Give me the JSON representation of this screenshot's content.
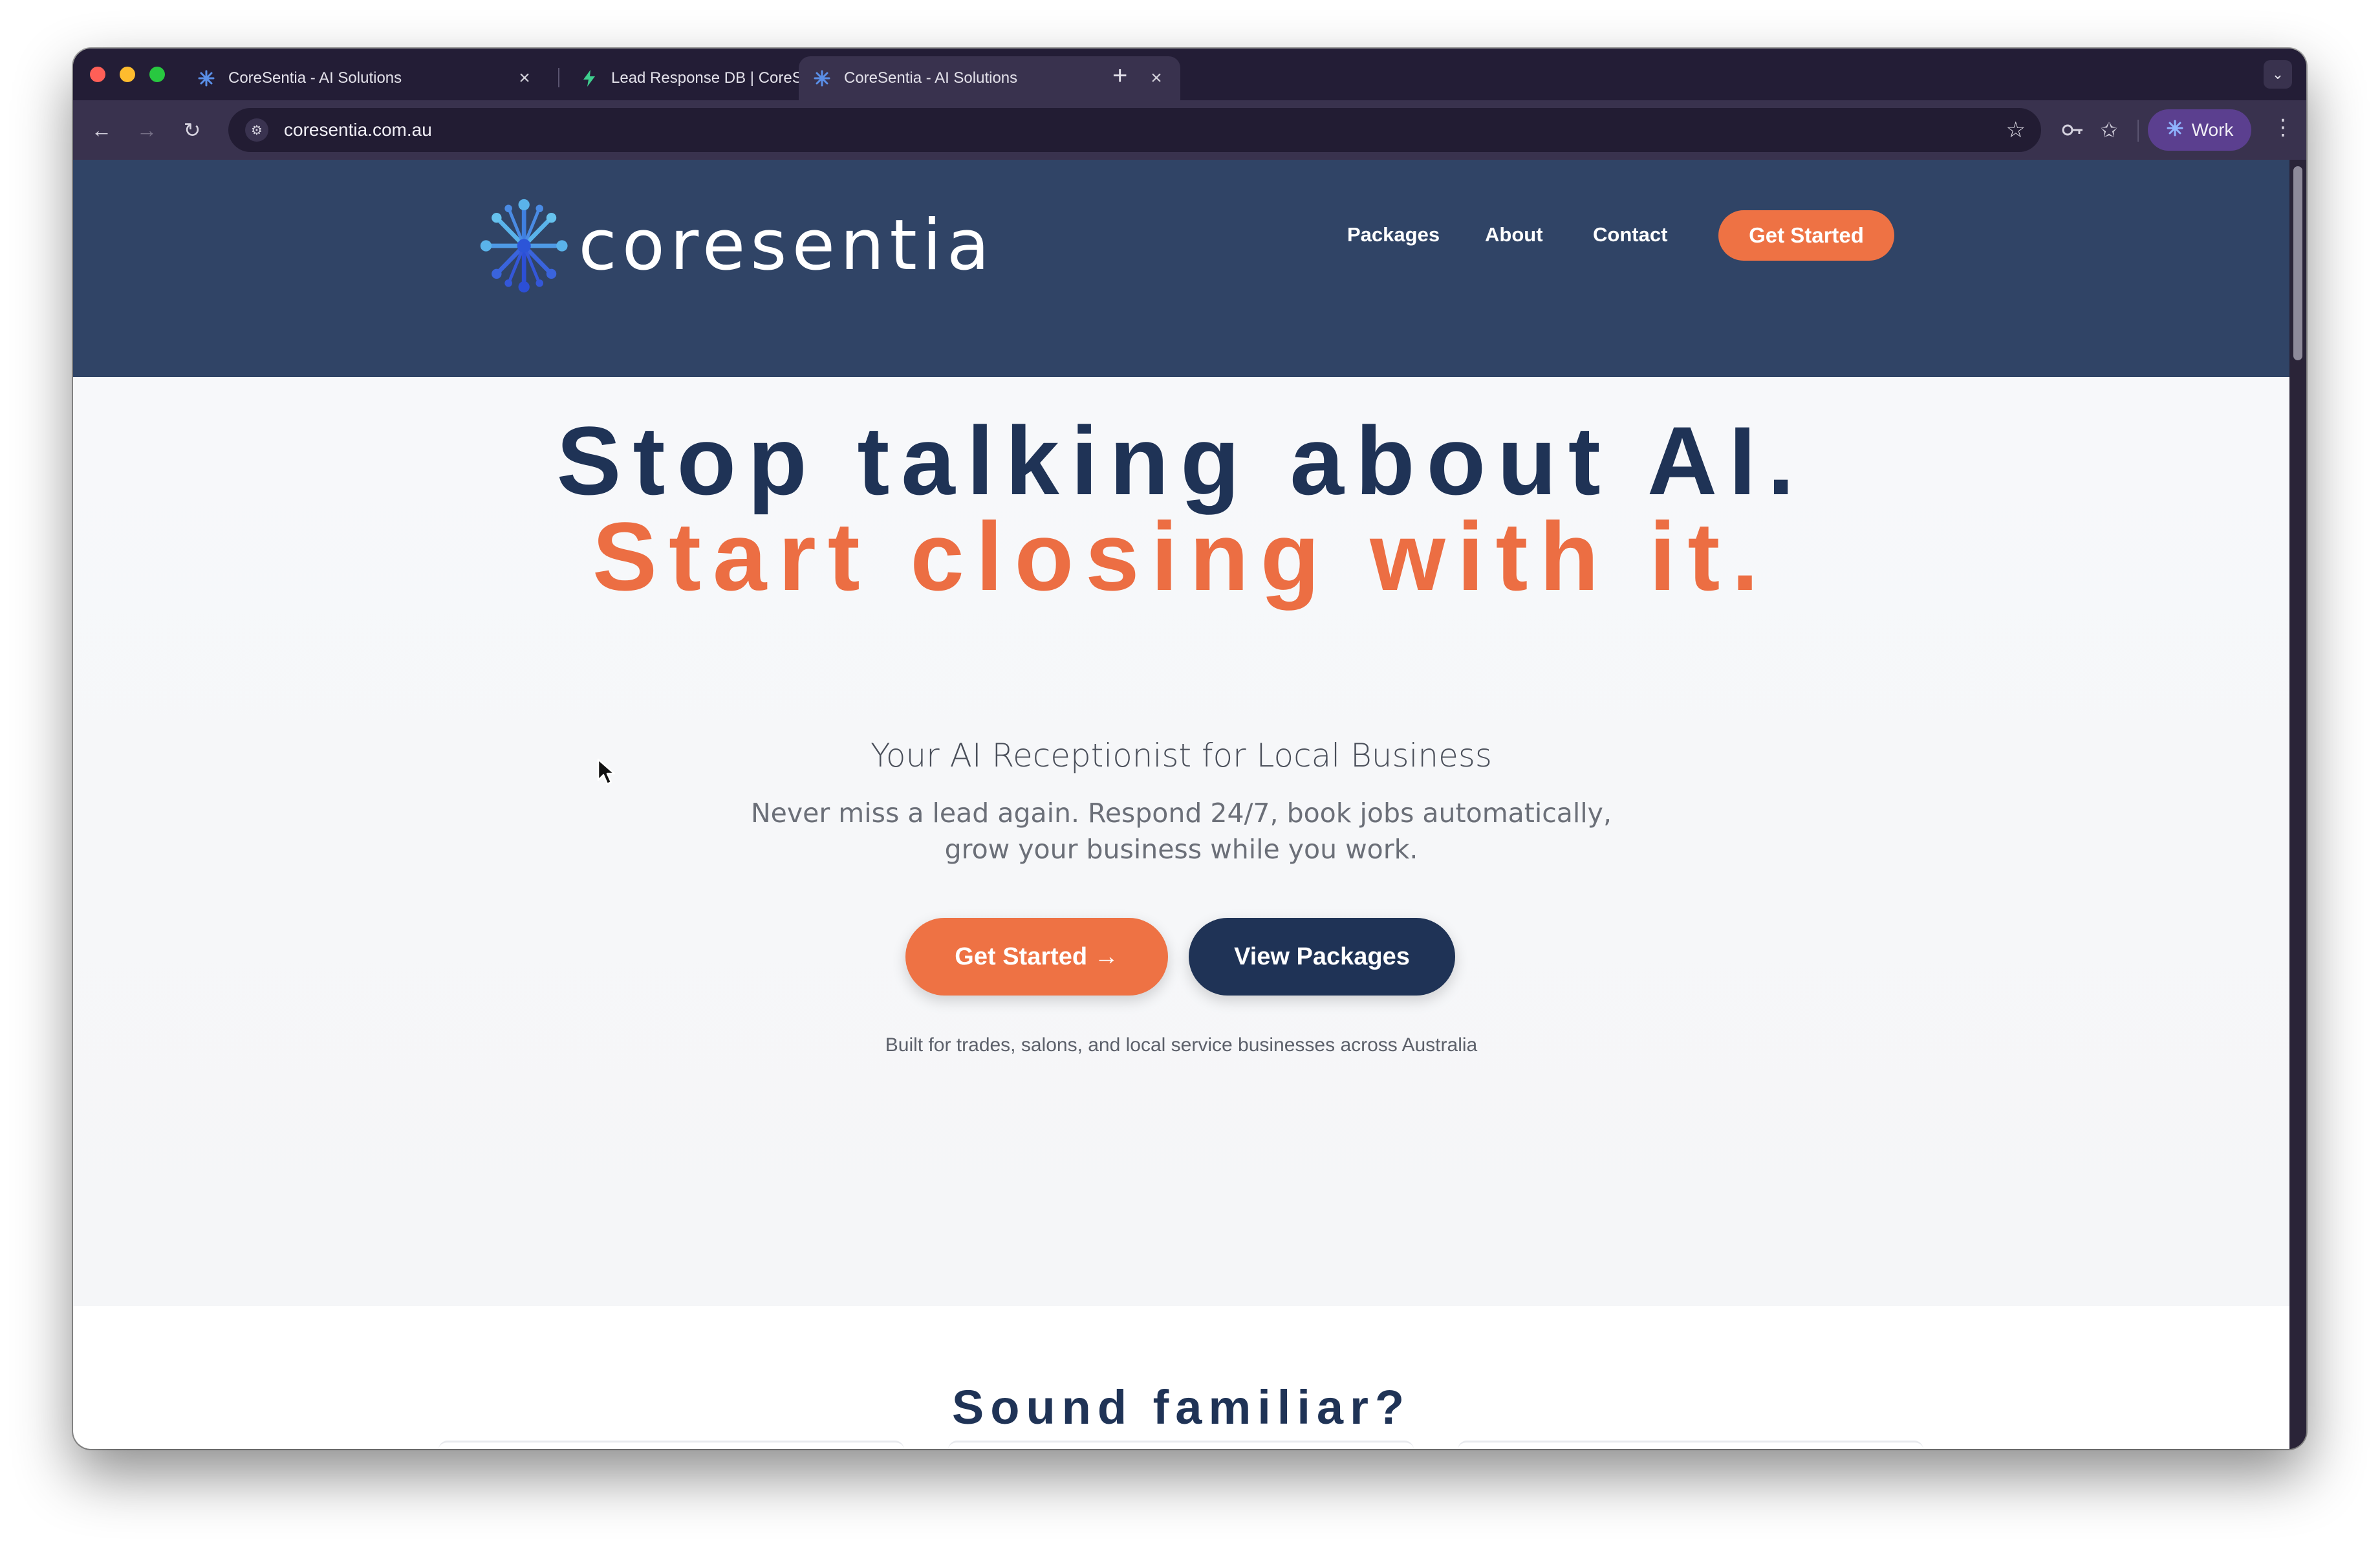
{
  "browser": {
    "tabs": [
      {
        "title": "CoreSentia - AI Solutions",
        "favicon": "coresentia-favicon",
        "active": false
      },
      {
        "title": "Lead Response DB | CoreSentia",
        "favicon": "bolt-favicon",
        "active": false
      },
      {
        "title": "CoreSentia - AI Solutions",
        "favicon": "coresentia-favicon",
        "active": true
      }
    ],
    "new_tab_label": "+",
    "close_glyph": "×",
    "url": "coresentia.com.au",
    "profile_label": "Work"
  },
  "site": {
    "logo_text": "coresentia",
    "nav": [
      "Packages",
      "About",
      "Contact"
    ],
    "nav_cta": "Get Started"
  },
  "hero": {
    "headline_line1": "Stop talking about AI.",
    "headline_line2": "Start closing with it.",
    "subheadline": "Your AI Receptionist for Local Business",
    "description": "Never miss a lead again. Respond 24/7, book jobs automatically, grow your business while you work.",
    "primary_button": "Get Started →",
    "secondary_button": "View Packages",
    "trust_line": "Built for trades, salons, and local service businesses across Australia"
  },
  "next_section": {
    "title": "Sound familiar?"
  },
  "colors": {
    "navy": "#1f3356",
    "header_bg": "#304466",
    "accent_orange": "#ee7244",
    "browser_frame": "#231d36",
    "profile_chip": "#5b3f8f"
  }
}
